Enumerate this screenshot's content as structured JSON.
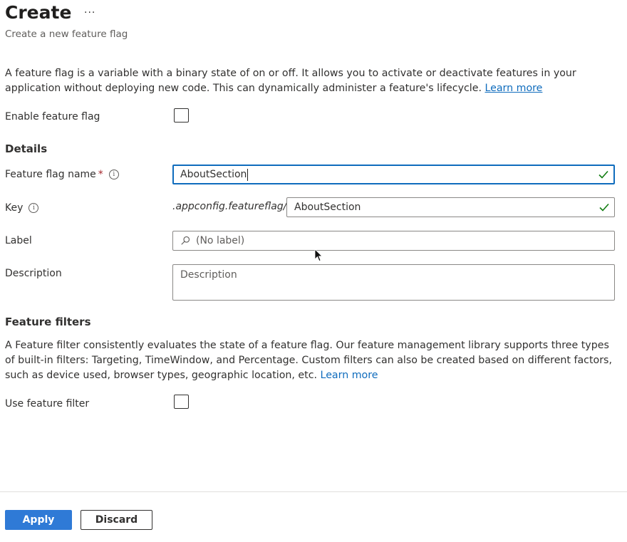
{
  "header": {
    "title": "Create",
    "more_label": "···",
    "subtitle": "Create a new feature flag"
  },
  "intro": {
    "text": "A feature flag is a variable with a binary state of on or off. It allows you to activate or deactivate features in your application without deploying new code. This can dynamically administer a feature's lifecycle.",
    "link": "Learn more"
  },
  "enable": {
    "label": "Enable feature flag",
    "checked": false
  },
  "details": {
    "heading": "Details",
    "name_label": "Feature flag name",
    "required_mark": "*",
    "info_glyph": "i",
    "name_value": "AboutSection",
    "key_label": "Key",
    "key_prefix": ".appconfig.featureflag/",
    "key_value": "AboutSection",
    "label_label": "Label",
    "label_placeholder": "(No label)",
    "description_label": "Description",
    "description_placeholder": "Description"
  },
  "filters": {
    "heading": "Feature filters",
    "text": "A Feature filter consistently evaluates the state of a feature flag. Our feature management library supports three types of built-in filters: Targeting, TimeWindow, and Percentage. Custom filters can also be created based on different factors, such as device used, browser types, geographic location, etc.",
    "link": "Learn more",
    "use_label": "Use feature filter",
    "checked": false
  },
  "footer": {
    "apply_label": "Apply",
    "discard_label": "Discard"
  },
  "colors": {
    "accent": "#0f6cbd",
    "primary_button": "#2f7ad6",
    "valid_check": "#107c10"
  }
}
